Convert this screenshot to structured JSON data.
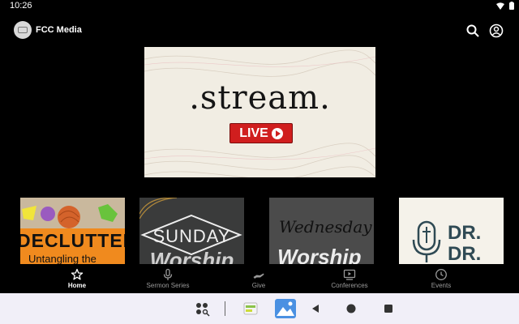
{
  "status": {
    "time": "10:26"
  },
  "header": {
    "title": "FCC Media"
  },
  "hero": {
    "title": ".stream.",
    "badge": "LIVE"
  },
  "row_cards": [
    {
      "title_top": "DECLUTTER",
      "title_bottom": "Untangling the"
    },
    {
      "title_top": "SUNDAY",
      "title_bottom": "Worship"
    },
    {
      "title_top": "Wednesday",
      "title_bottom": "Worship"
    },
    {
      "title_top": "DR.",
      "title_bottom": "DR."
    }
  ],
  "nav": {
    "items": [
      {
        "label": "Home",
        "icon": "star-icon",
        "active": true
      },
      {
        "label": "Sermon Series",
        "icon": "mic-icon"
      },
      {
        "label": "Give",
        "icon": "give-icon"
      },
      {
        "label": "Conferences",
        "icon": "video-icon"
      },
      {
        "label": "Events",
        "icon": "clock-icon"
      }
    ]
  },
  "colors": {
    "background": "#000000",
    "live": "#d01e1e",
    "system_bar": "#f1eff8"
  }
}
